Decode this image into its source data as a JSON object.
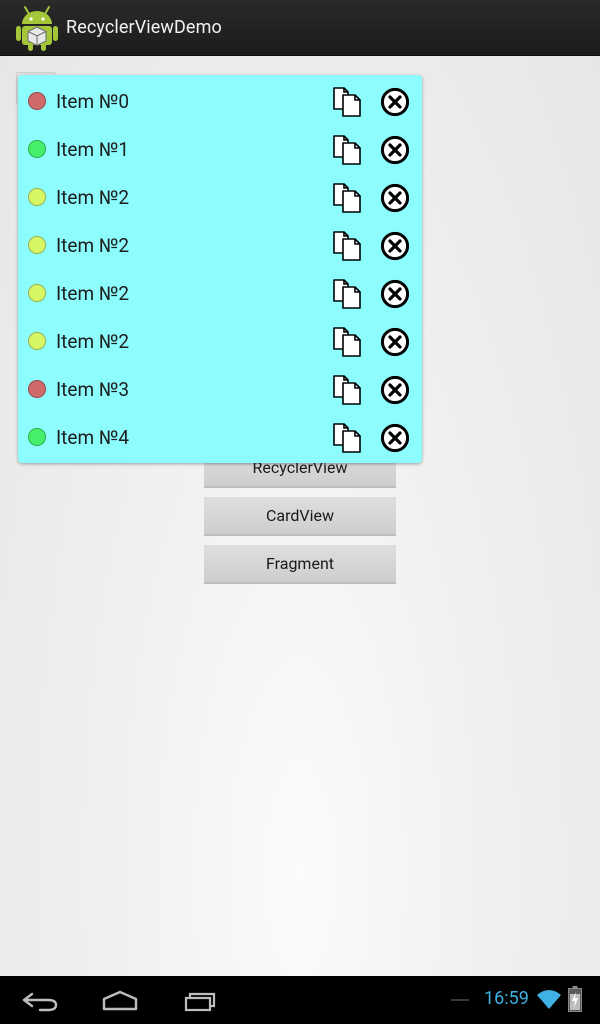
{
  "app": {
    "title": "RecyclerViewDemo",
    "icon": "android-robot-icon"
  },
  "buttons": [
    {
      "label": "RecyclerView"
    },
    {
      "label": "CardView"
    },
    {
      "label": "Fragment"
    }
  ],
  "popup": {
    "background": "#8cfcfd",
    "items": [
      {
        "label": "Item №0",
        "status_color": "#d06a6a"
      },
      {
        "label": "Item №1",
        "status_color": "#45f06a"
      },
      {
        "label": "Item №2",
        "status_color": "#d6f763"
      },
      {
        "label": "Item №2",
        "status_color": "#d6f763"
      },
      {
        "label": "Item №2",
        "status_color": "#d6f763"
      },
      {
        "label": "Item №2",
        "status_color": "#d6f763"
      },
      {
        "label": "Item №3",
        "status_color": "#d06a6a"
      },
      {
        "label": "Item №4",
        "status_color": "#45f06a"
      }
    ],
    "item_actions": [
      "copy-icon",
      "remove-circle-x-icon"
    ]
  },
  "system_bar": {
    "time": "16:59",
    "icons": [
      "back-icon",
      "home-icon",
      "recent-apps-icon",
      "wifi-icon",
      "battery-icon"
    ]
  }
}
